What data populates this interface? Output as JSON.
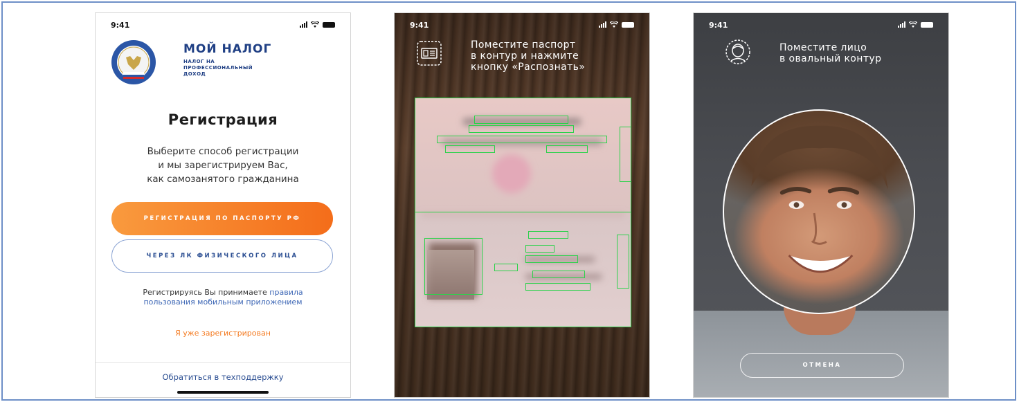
{
  "screens": [
    {
      "status_time": "9:41",
      "brand_title": "МОЙ НАЛОГ",
      "brand_sub_lines": [
        "НАЛОГ НА",
        "ПРОФЕССИОНАЛЬНЫЙ",
        "ДОХОД"
      ],
      "title": "Регистрация",
      "description_lines": [
        "Выберите способ регистрации",
        "и мы зарегистрируем Вас,",
        "как самозанятого гражданина"
      ],
      "btn_passport": "РЕГИСТРАЦИЯ ПО ПАСПОРТУ РФ",
      "btn_personal": "ЧЕРЕЗ ЛК ФИЗИЧЕСКОГО ЛИЦА",
      "terms_prefix": "Регистрируясь Вы принимаете ",
      "terms_link_1": "правила",
      "terms_link_2": "пользования мобильным приложением",
      "already": "Я уже зарегистрирован",
      "support": "Обратиться в техподдержку"
    },
    {
      "status_time": "9:41",
      "instruction_lines": [
        "Поместите паспорт",
        "в контур и нажмите",
        "кнопку «Распознать»"
      ]
    },
    {
      "status_time": "9:41",
      "instruction_lines": [
        "Поместите лицо",
        "в овальный контур"
      ],
      "btn_cancel": "ОТМЕНА"
    }
  ],
  "colors": {
    "brand_blue": "#1f3f84",
    "orange_start": "#f99a3e",
    "orange_end": "#f46d1a",
    "link_blue": "#3c66b5",
    "frame_green": "#2bd24a"
  },
  "icons": [
    "signal-icon",
    "wifi-icon",
    "battery-icon",
    "emblem-logo",
    "id-card-icon",
    "face-scan-icon"
  ]
}
